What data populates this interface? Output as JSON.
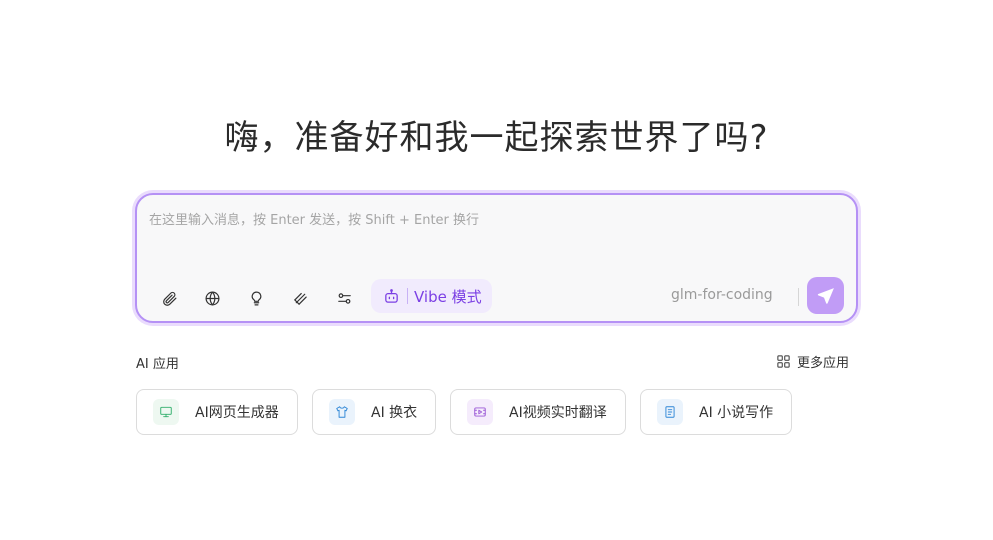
{
  "headline": "嗨，准备好和我一起探索世界了吗?",
  "composer": {
    "placeholder": "在这里输入消息，按 Enter 发送，按 Shift + Enter 换行",
    "vibe_label": "Vibe 模式",
    "model_label": "glm-for-coding",
    "tools": [
      "paperclip-icon",
      "globe-icon",
      "lightbulb-icon",
      "deep-think-icon",
      "settings-sliders-icon"
    ]
  },
  "apps": {
    "title": "AI 应用",
    "more_label": "更多应用",
    "items": [
      {
        "label": "AI网页生成器",
        "icon": "monitor-icon",
        "color": "#2fae6a",
        "bg": "#eef8f1"
      },
      {
        "label": "AI 换衣",
        "icon": "shirt-icon",
        "color": "#2e86d6",
        "bg": "#eaf3fc"
      },
      {
        "label": "AI视频实时翻译",
        "icon": "video-icon",
        "color": "#9b59d6",
        "bg": "#f5ecfc"
      },
      {
        "label": "AI 小说写作",
        "icon": "book-icon",
        "color": "#2e86d6",
        "bg": "#eaf3fc"
      }
    ]
  },
  "colors": {
    "accent": "#b591f5",
    "vibe_text": "#7b3fe4",
    "send_bg": "#c19cf6"
  }
}
